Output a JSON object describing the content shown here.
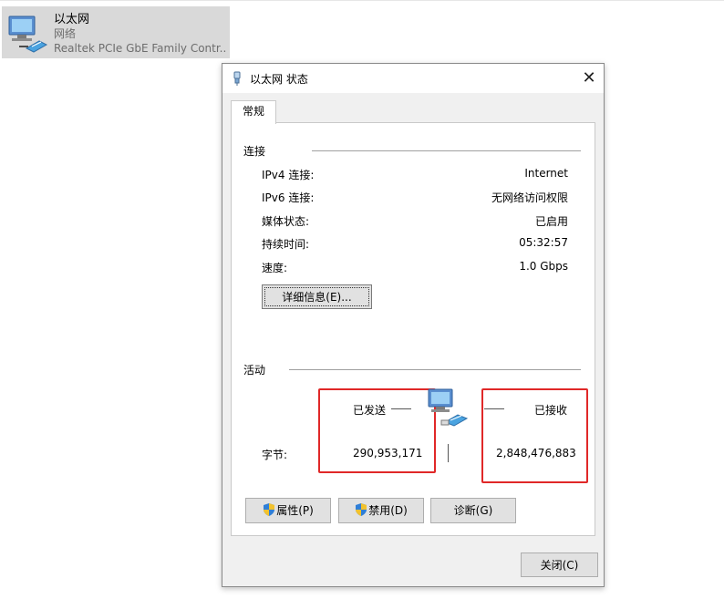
{
  "adapter": {
    "name": "以太网",
    "network": "网络",
    "device": "Realtek PCIe GbE Family Contr..."
  },
  "dialog": {
    "title": "以太网 状态",
    "close_glyph": "✕",
    "tab": "常规",
    "connection": {
      "heading": "连接",
      "rows": [
        {
          "label": "IPv4 连接:",
          "value": "Internet"
        },
        {
          "label": "IPv6 连接:",
          "value": "无网络访问权限"
        },
        {
          "label": "媒体状态:",
          "value": "已启用"
        },
        {
          "label": "持续时间:",
          "value": "05:32:57"
        },
        {
          "label": "速度:",
          "value": "1.0 Gbps"
        }
      ],
      "details_button": "详细信息(E)..."
    },
    "activity": {
      "heading": "活动",
      "sent_label": "已发送",
      "received_label": "已接收",
      "bytes_label": "字节:",
      "bytes_sent": "290,953,171",
      "bytes_received": "2,848,476,883"
    },
    "buttons": {
      "properties": "属性(P)",
      "disable": "禁用(D)",
      "diagnose": "诊断(G)",
      "close": "关闭(C)"
    }
  },
  "colors": {
    "highlight_box": "#e02828",
    "dialog_bg": "#f0f0f0",
    "button_bg": "#e1e1e1"
  },
  "icons": [
    "network-adapter-icon",
    "ethernet-plug-icon",
    "network-activity-icon",
    "uac-shield-icon",
    "close-icon"
  ]
}
